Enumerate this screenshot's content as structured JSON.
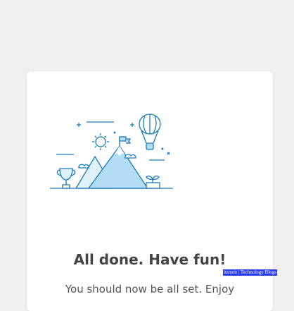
{
  "card": {
    "illustration": "mountain-flag-balloon-trophy-illustration",
    "title": "All done. Have fun!",
    "subtitle": "You should now be all set. Enjoy"
  },
  "watermark": "itsmeit | Technology Blogs",
  "colors": {
    "accent": "#1a7ab8",
    "fill": "#b3dcf5",
    "background": "#f0f0f0"
  }
}
